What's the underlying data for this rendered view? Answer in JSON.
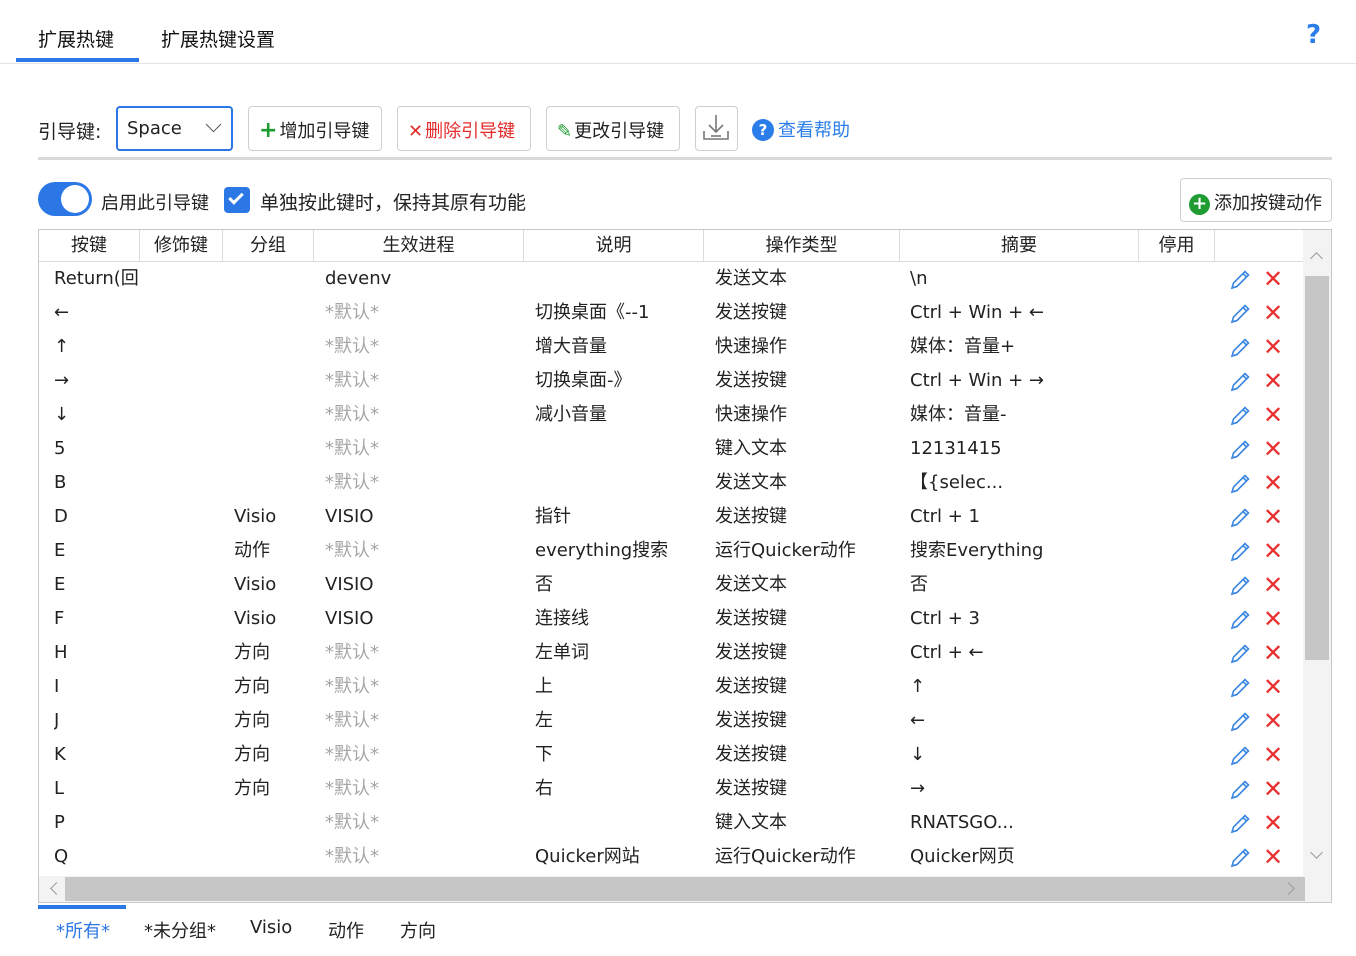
{
  "tabs": [
    "扩展热键",
    "扩展热键设置"
  ],
  "help_icon": "?",
  "toolbar": {
    "lead_label": "引导键:",
    "selected_key": "Space",
    "add_label": "增加引导键",
    "delete_label": "删除引导键",
    "change_label": "更改引导键",
    "help_label": "查看帮助"
  },
  "options": {
    "enable_label": "启用此引导键",
    "enabled": true,
    "keep_label": "单独按此键时，保持其原有功能",
    "keep_checked": true,
    "add_action_label": "添加按键动作"
  },
  "table": {
    "headers": [
      "按键",
      "修饰键",
      "分组",
      "生效进程",
      "说明",
      "操作类型",
      "摘要",
      "停用"
    ],
    "rows": [
      {
        "key": "Return(回",
        "mod": "",
        "group": "",
        "process": "devenv",
        "desc": "",
        "type": "发送文本",
        "summary": "\\n"
      },
      {
        "key": "←",
        "mod": "",
        "group": "",
        "process": "*默认*",
        "desc": "切换桌面《--1",
        "type": "发送按键",
        "summary": "Ctrl + Win + ←"
      },
      {
        "key": "↑",
        "mod": "",
        "group": "",
        "process": "*默认*",
        "desc": "增大音量",
        "type": "快速操作",
        "summary": "媒体：音量+"
      },
      {
        "key": "→",
        "mod": "",
        "group": "",
        "process": "*默认*",
        "desc": "切换桌面-》",
        "type": "发送按键",
        "summary": "Ctrl + Win + →"
      },
      {
        "key": "↓",
        "mod": "",
        "group": "",
        "process": "*默认*",
        "desc": "减小音量",
        "type": "快速操作",
        "summary": "媒体：音量-"
      },
      {
        "key": "5",
        "mod": "",
        "group": "",
        "process": "*默认*",
        "desc": "",
        "type": "键入文本",
        "summary": "12131415"
      },
      {
        "key": "B",
        "mod": "",
        "group": "",
        "process": "*默认*",
        "desc": "",
        "type": "发送文本",
        "summary": "【{selec..."
      },
      {
        "key": "D",
        "mod": "",
        "group": "Visio",
        "process": "VISIO",
        "desc": "指针",
        "type": "发送按键",
        "summary": "Ctrl + 1"
      },
      {
        "key": "E",
        "mod": "",
        "group": "动作",
        "process": "*默认*",
        "desc": "everything搜索",
        "type": "运行Quicker动作",
        "summary": "搜索Everything"
      },
      {
        "key": "E",
        "mod": "",
        "group": "Visio",
        "process": "VISIO",
        "desc": "否",
        "type": "发送文本",
        "summary": "否"
      },
      {
        "key": "F",
        "mod": "",
        "group": "Visio",
        "process": "VISIO",
        "desc": "连接线",
        "type": "发送按键",
        "summary": "Ctrl + 3"
      },
      {
        "key": "H",
        "mod": "",
        "group": "方向",
        "process": "*默认*",
        "desc": "左单词",
        "type": "发送按键",
        "summary": "Ctrl + ←"
      },
      {
        "key": "I",
        "mod": "",
        "group": "方向",
        "process": "*默认*",
        "desc": "上",
        "type": "发送按键",
        "summary": "↑"
      },
      {
        "key": "J",
        "mod": "",
        "group": "方向",
        "process": "*默认*",
        "desc": "左",
        "type": "发送按键",
        "summary": "←"
      },
      {
        "key": "K",
        "mod": "",
        "group": "方向",
        "process": "*默认*",
        "desc": "下",
        "type": "发送按键",
        "summary": "↓"
      },
      {
        "key": "L",
        "mod": "",
        "group": "方向",
        "process": "*默认*",
        "desc": "右",
        "type": "发送按键",
        "summary": "→"
      },
      {
        "key": "P",
        "mod": "",
        "group": "",
        "process": "*默认*",
        "desc": "",
        "type": "键入文本",
        "summary": "RNATSGO..."
      },
      {
        "key": "Q",
        "mod": "",
        "group": "",
        "process": "*默认*",
        "desc": "Quicker网站",
        "type": "运行Quicker动作",
        "summary": "Quicker网页"
      }
    ]
  },
  "bottom_tabs": [
    "*所有*",
    "*未分组*",
    "Visio",
    "动作",
    "方向"
  ],
  "colors": {
    "accent": "#2b77e6",
    "add_green": "#1e9b31",
    "delete_red": "#e32b2b",
    "muted": "#a6a6a6"
  }
}
